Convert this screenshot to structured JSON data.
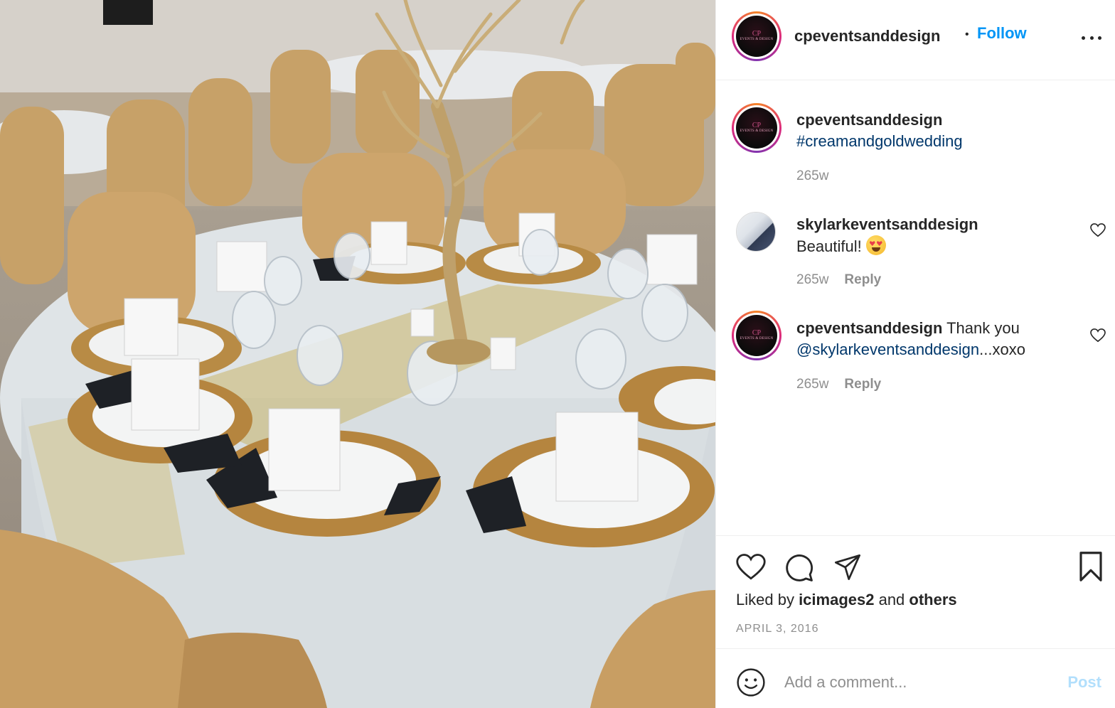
{
  "post": {
    "image_description_icon": "photo-wedding-table",
    "author": "cpeventsanddesign",
    "dot": "•",
    "follow_label": "Follow",
    "avatar_logo_mark": "CP",
    "avatar_logo_text": "EVENTS & DESIGN"
  },
  "caption": {
    "username": "cpeventsanddesign",
    "text": "#creamandgoldwedding",
    "time": "265w"
  },
  "comments": [
    {
      "username": "skylarkeventsanddesign",
      "text": "Beautiful!",
      "emoji_icon": "heart-eyes-emoji",
      "time": "265w",
      "reply_label": "Reply"
    },
    {
      "username": "cpeventsanddesign",
      "text_before": " Thank you",
      "mention": "@skylarkeventsanddesign",
      "text_after": "...xoxo",
      "time": "265w",
      "reply_label": "Reply"
    }
  ],
  "actions": {
    "liked_prefix": "Liked by ",
    "liked_user": "icimages2",
    "liked_mid": " and ",
    "liked_others": "others",
    "date": "APRIL 3, 2016"
  },
  "add_comment": {
    "placeholder": "Add a comment...",
    "post_label": "Post"
  },
  "colors": {
    "follow": "#0095f6",
    "link": "#00376b",
    "muted": "#8e8e8e",
    "post_disabled": "#b2dffc"
  }
}
